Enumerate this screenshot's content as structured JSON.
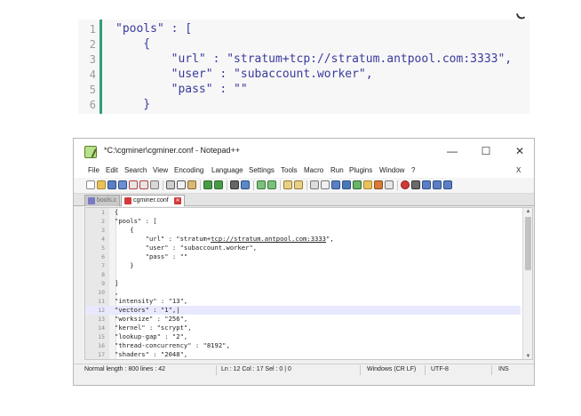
{
  "snippet": {
    "lines": [
      {
        "num": "1",
        "code": "\"pools\" : ["
      },
      {
        "num": "2",
        "code": "    {"
      },
      {
        "num": "3",
        "code": "        \"url\" : \"stratum+tcp://stratum.antpool.com:3333\","
      },
      {
        "num": "4",
        "code": "        \"user\" : \"subaccount.worker\","
      },
      {
        "num": "5",
        "code": "        \"pass\" : \"\""
      },
      {
        "num": "6",
        "code": "    }"
      }
    ]
  },
  "window": {
    "title": "*C:\\cgminer\\cgminer.conf - Notepad++",
    "controls": {
      "minimize": "—",
      "maximize": "☐",
      "close": "✕"
    },
    "menu": [
      "File",
      "Edit",
      "Search",
      "View",
      "Encoding",
      "Language",
      "Settings",
      "Tools",
      "Macro",
      "Run",
      "Plugins",
      "Window",
      "?"
    ],
    "menu_close": "X",
    "tabs": [
      {
        "label": "bools.c",
        "close": "✕"
      },
      {
        "label": "cgminer.conf",
        "close": "✕"
      }
    ],
    "editor": {
      "lines": [
        {
          "num": "1",
          "code": "{"
        },
        {
          "num": "2",
          "code": "\"pools\" : ["
        },
        {
          "num": "3",
          "code": "    {"
        },
        {
          "num": "4",
          "code": "        \"url\" : \"stratum+",
          "url": "tcp://stratum.antpool.com:3333",
          "tail": "\","
        },
        {
          "num": "5",
          "code": "        \"user\" : \"subaccount.worker\","
        },
        {
          "num": "6",
          "code": "        \"pass\" : \"\""
        },
        {
          "num": "7",
          "code": "    }"
        },
        {
          "num": "8",
          "code": ""
        },
        {
          "num": "9",
          "code": "]"
        },
        {
          "num": "10",
          "code": ","
        },
        {
          "num": "11",
          "code": "\"intensity\" : \"13\","
        },
        {
          "num": "12",
          "code": "\"vectors\" : \"1\",|"
        },
        {
          "num": "13",
          "code": "\"worksize\" : \"256\","
        },
        {
          "num": "14",
          "code": "\"kernel\" : \"scrypt\","
        },
        {
          "num": "15",
          "code": "\"lookup-gap\" : \"2\","
        },
        {
          "num": "16",
          "code": "\"thread-concurrency\" : \"8192\","
        },
        {
          "num": "17",
          "code": "\"shaders\" : \"2048\","
        }
      ],
      "current_line": 12
    },
    "status": {
      "length": "Normal length : 800    lines : 42",
      "position": "Ln : 12    Col : 17    Sel : 0 | 0",
      "eol": "Windows (CR LF)",
      "encoding": "UTF-8",
      "mode": "INS"
    }
  },
  "colors": {
    "accent_bar": "#2e9c7e",
    "code_text": "#3a3a9e",
    "current_line": "#e8e8ff"
  },
  "icons": [
    "notepadpp-app-icon",
    "new-file-icon",
    "open-file-icon",
    "save-icon",
    "save-all-icon",
    "close-icon",
    "close-all-icon",
    "print-icon",
    "cut-icon",
    "copy-icon",
    "paste-icon",
    "undo-icon",
    "redo-icon",
    "find-icon",
    "replace-icon",
    "zoom-in-icon",
    "zoom-out-icon",
    "sync-v-icon",
    "sync-h-icon",
    "wrap-icon",
    "all-chars-icon",
    "indent-guide-icon",
    "lang-icon",
    "doc-map-icon",
    "function-list-icon",
    "folder-workspace-icon",
    "monitor-icon",
    "record-macro-icon",
    "stop-macro-icon",
    "play-macro-icon",
    "run-macro-multi-icon",
    "save-macro-icon"
  ]
}
